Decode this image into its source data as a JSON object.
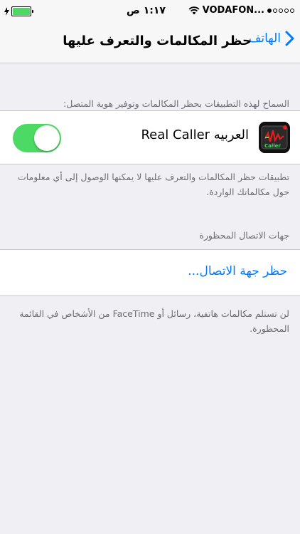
{
  "status_bar": {
    "time": "١:١٧ ص",
    "carrier": "VODAFON...",
    "battery_color": "#4cd964"
  },
  "nav": {
    "back_label": "الهاتف",
    "title": "حظر المكالمات والتعرف عليها",
    "accent": "#007aff"
  },
  "apps_section": {
    "header": "السماح لهذه التطبيقات بحظر المكالمات وتوفير هوية المتصل:",
    "app": {
      "name": "العربيه Real Caller",
      "icon_text": "Caller",
      "enabled": true
    },
    "footer": "تطبيقات حظر المكالمات والتعرف عليها لا يمكنها الوصول إلى أي معلومات حول مكالماتك الواردة."
  },
  "blocked_section": {
    "header": "جهات الاتصال المحظورة",
    "block_contact_label": "حظر جهة الاتصال...",
    "footer": "لن تستلم مكالمات هاتفية، رسائل أو FaceTime من الأشخاص في القائمة المحظورة."
  }
}
